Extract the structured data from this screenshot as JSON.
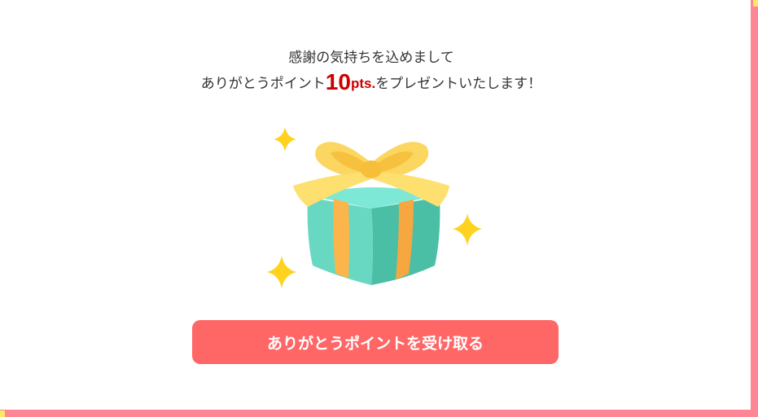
{
  "message": {
    "line1": "感謝の気持ちを込めまして",
    "line2_before": "ありがとうポイント",
    "points_value": "10",
    "points_unit": "pts.",
    "line2_after": "をプレゼントいたします！"
  },
  "button": {
    "label": "ありがとうポイントを受け取る"
  },
  "icons": {
    "gift": "gift-box-icon",
    "sparkle": "sparkle-icon"
  },
  "colors": {
    "frame": "#ff8795",
    "corner_accent": "#fbe967",
    "points_text": "#cc0000",
    "button_bg": "#ff6767",
    "gift_box": "#5fd3b9",
    "gift_ribbon": "#fbd660"
  }
}
